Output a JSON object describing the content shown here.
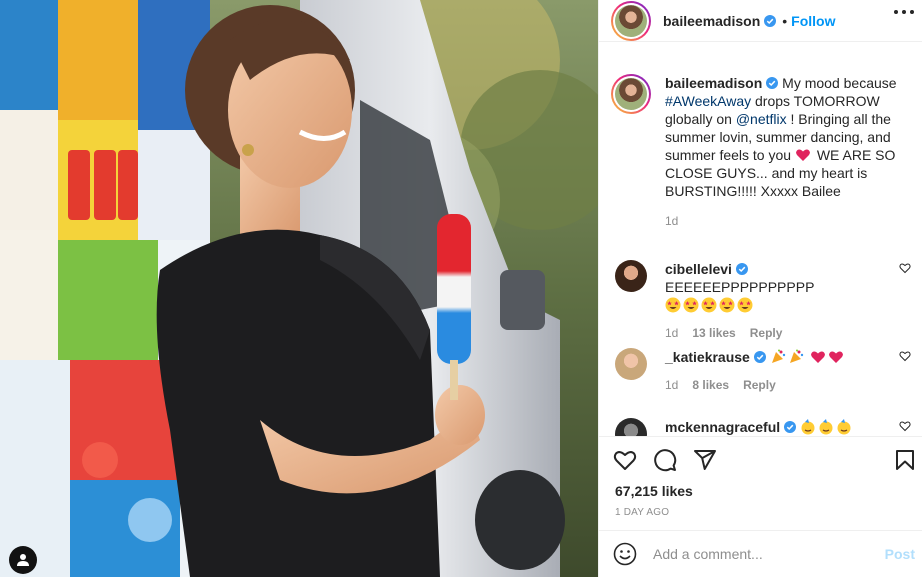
{
  "post": {
    "username": "baileemadison",
    "follow_label": "Follow",
    "separator": "•",
    "caption": {
      "prefix": "My mood because ",
      "hashtag": "#AWeekAway",
      "mid": " drops TOMORROW globally on ",
      "mention": "@netflix",
      "rest": " ! Bringing all the summer lovin, summer dancing, and summer feels to you ",
      "heart": "❤️",
      "end": " WE ARE SO CLOSE GUYS... and my heart is BURSTING!!!!! Xxxxx Bailee",
      "time": "1d"
    },
    "likes": "67,215 likes",
    "posted_ago": "1 DAY AGO"
  },
  "comments": [
    {
      "username": "cibellelevi",
      "verified": true,
      "text": "EEEEEEPPPPPPPPPP",
      "emojis": [
        "🤩",
        "🤩",
        "🤩",
        "🤩",
        "🤩"
      ],
      "time": "1d",
      "likes": "13 likes",
      "reply": "Reply"
    },
    {
      "username": "_katiekrause",
      "verified": true,
      "text": "",
      "emojis": [
        "🎉",
        "🎉",
        "❤️",
        "❤️"
      ],
      "time": "1d",
      "likes": "8 likes",
      "reply": "Reply"
    },
    {
      "username": "mckennagraceful",
      "verified": true,
      "text": "",
      "emojis": [
        "🥳",
        "🥳",
        "🥳"
      ]
    }
  ],
  "add_comment": {
    "placeholder": "Add a comment...",
    "post_label": "Post"
  },
  "icons": {
    "like": "heart-icon",
    "comment": "comment-bubble-icon",
    "share": "paper-plane-icon",
    "save": "bookmark-icon",
    "emoji": "smiley-icon",
    "more": "more-options-icon",
    "tag": "user-tag-icon"
  },
  "colors": {
    "accent": "#0095f6",
    "verified": "#3897f0",
    "link": "#00376b",
    "muted": "#8e8e8e",
    "post_disabled": "#b2dffc",
    "heart_emoji": "#e0245e"
  }
}
